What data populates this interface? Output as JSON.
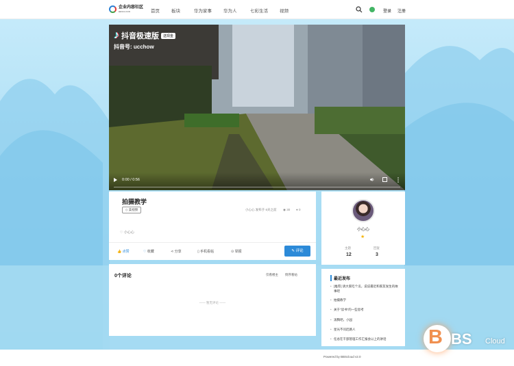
{
  "header": {
    "logo_text": "企业内容社区",
    "logo_sub": "BBSCLOUD",
    "nav": [
      "首页",
      "板块",
      "华为家事",
      "华为人",
      "七彩生活",
      "视频"
    ],
    "login": "登录",
    "register": "注册"
  },
  "video": {
    "app_name": "抖音极速版",
    "badge": "送现金",
    "account_id": "抖音号: ucchow",
    "time": "0:00 / 0:56"
  },
  "post": {
    "title": "拍摄教学",
    "tag": "◇ 美视频",
    "meta": "小心心  发布于 6天之前",
    "views": "30",
    "comments": "0",
    "body": "小心心",
    "actions": {
      "like": "点赞",
      "favorite": "收藏",
      "share": "分享",
      "mobile": "手机看帖",
      "report": "举报",
      "comment": "评论"
    }
  },
  "author": {
    "name": "小心心",
    "star": "★",
    "stats": [
      {
        "label": "主题",
        "value": "12"
      },
      {
        "label": "回复",
        "value": "3"
      }
    ]
  },
  "comments": {
    "title": "0个评论",
    "only_op": "仅看楼主",
    "reverse": "倒序看帖",
    "empty": "—— 暂无评论 ——"
  },
  "recent": {
    "title": "最近发布",
    "items": [
      "[推荐] 请大家吃个瓜，说说最近和家友发生的故事吧",
      "拍摄教学",
      "关于\"读书\"的一些思考",
      "滚胸吧，小园",
      "星光不问赶路人",
      "任总在干部管理工作汇报会以上的讲话"
    ]
  },
  "footer": {
    "powered": "Powered by BBScloud v2.0"
  },
  "watermark": {
    "b": "B",
    "bs": "BS",
    "cloud": "Cloud"
  }
}
